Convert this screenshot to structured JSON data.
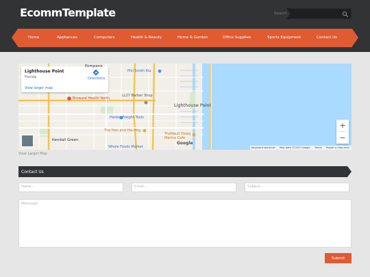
{
  "site": {
    "logo": "EcommTemplate"
  },
  "search": {
    "label": "Search",
    "placeholder": "",
    "icon": "search-icon"
  },
  "nav": {
    "items": [
      "Home",
      "Appliances",
      "Computers",
      "Health & Beauty",
      "Home & Garden",
      "Office Supplies",
      "Sports Equipment",
      "Contact Us"
    ]
  },
  "map": {
    "place_name": "Lighthouse Point",
    "place_region": "Florida",
    "view_larger_link": "View larger map",
    "directions": "Directions",
    "labels": {
      "town": "Lighthouse Point",
      "kendall": "Kendall Green",
      "pompano": "Pompano",
      "phil_smith": "Phil Smith Kia",
      "broward": "Broward Health North",
      "barber": "LL27 Barber Shop",
      "harbor": "Harbor Freight Tools",
      "hen": "The Hen and the Hog",
      "nauti": "TheNauti Dawg Marina Cafe",
      "whole_foods": "Whole Foods Market",
      "google": "Google"
    },
    "zoom_in": "+",
    "zoom_out": "−",
    "footer": {
      "shortcuts": "Keyboard shortcuts",
      "data": "Map data ©2023 Google",
      "terms": "Terms",
      "report": "Report a map error"
    },
    "water_color": "#aadaff",
    "road_color": "#f5c34d"
  },
  "view_larger_map": "View Larger Map",
  "contact": {
    "title": "Contact Us",
    "name_placeholder": "Name...",
    "email_placeholder": "Email...",
    "subject_placeholder": "Subject...",
    "message_placeholder": "Message",
    "submit_label": "Submit"
  },
  "colors": {
    "accent": "#e05a32",
    "dark": "#313335",
    "background": "#e6e6e6"
  }
}
